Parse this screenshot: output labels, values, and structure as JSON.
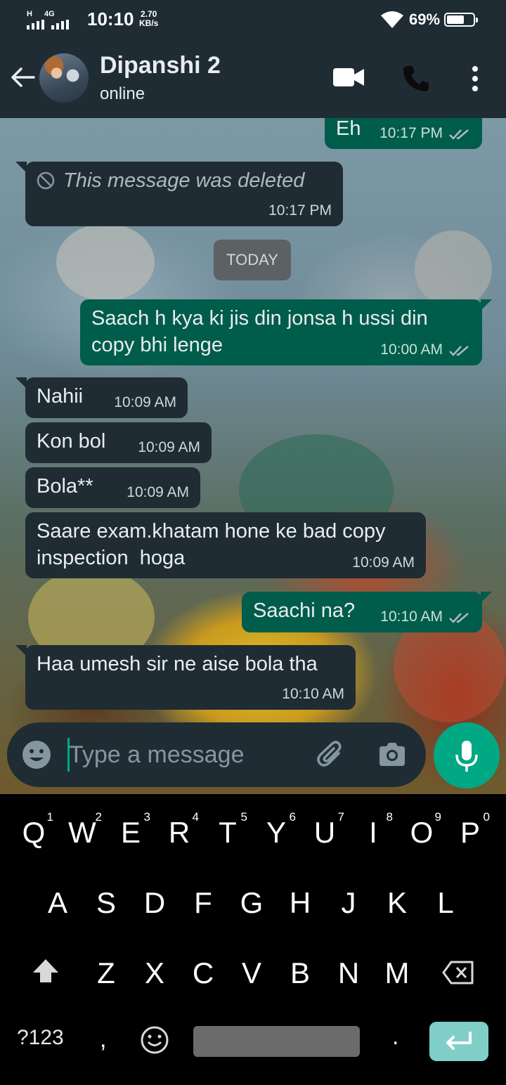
{
  "status_bar": {
    "network": "H",
    "network2": "4G",
    "time": "10:10",
    "speed_value": "2.70",
    "speed_unit": "KB/s",
    "battery": "69%"
  },
  "header": {
    "contact_name": "Dipanshi 2",
    "contact_status": "online"
  },
  "messages": [
    {
      "direction": "out",
      "text": "Eh",
      "time": "10:17 PM",
      "read": true
    },
    {
      "direction": "in",
      "text": "This message was deleted",
      "time": "10:17 PM",
      "deleted": true
    },
    {
      "direction": "out",
      "text": "Saach h kya ki jis din jonsa h ussi din copy bhi lenge",
      "time": "10:00 AM",
      "read": true
    },
    {
      "direction": "in",
      "text": "Nahii",
      "time": "10:09 AM"
    },
    {
      "direction": "in",
      "text": "Kon bol",
      "time": "10:09 AM"
    },
    {
      "direction": "in",
      "text": "Bola**",
      "time": "10:09 AM"
    },
    {
      "direction": "in",
      "text": "Saare exam.khatam hone ke bad copy inspection  hoga",
      "time": "10:09 AM"
    },
    {
      "direction": "out",
      "text": "Saachi na?",
      "time": "10:10 AM",
      "read": true
    },
    {
      "direction": "in",
      "text": "Haa umesh sir ne aise bola tha",
      "time": "10:10 AM"
    }
  ],
  "date_divider": "TODAY",
  "composer": {
    "placeholder": "Type a message"
  },
  "keyboard": {
    "row1": [
      "Q",
      "W",
      "E",
      "R",
      "T",
      "Y",
      "U",
      "I",
      "O",
      "P"
    ],
    "row1_numbers": [
      "1",
      "2",
      "3",
      "4",
      "5",
      "6",
      "7",
      "8",
      "9",
      "0"
    ],
    "row2": [
      "A",
      "S",
      "D",
      "F",
      "G",
      "H",
      "J",
      "K",
      "L"
    ],
    "row3": [
      "Z",
      "X",
      "C",
      "V",
      "B",
      "N",
      "M"
    ],
    "symbols_key": "?123",
    "comma_key": ",",
    "period_key": "."
  },
  "colors": {
    "header_bg": "#1f2c34",
    "incoming_bubble": "#202c33",
    "outgoing_bubble": "#005c4b",
    "accent": "#00a884",
    "read_ticks": "#53bdeb"
  },
  "icons": [
    "back-arrow-icon",
    "video-call-icon",
    "phone-icon",
    "more-options-icon",
    "deleted-icon",
    "double-check-icon",
    "emoji-icon",
    "attach-icon",
    "camera-icon",
    "mic-icon",
    "shift-icon",
    "backspace-icon",
    "enter-icon"
  ]
}
